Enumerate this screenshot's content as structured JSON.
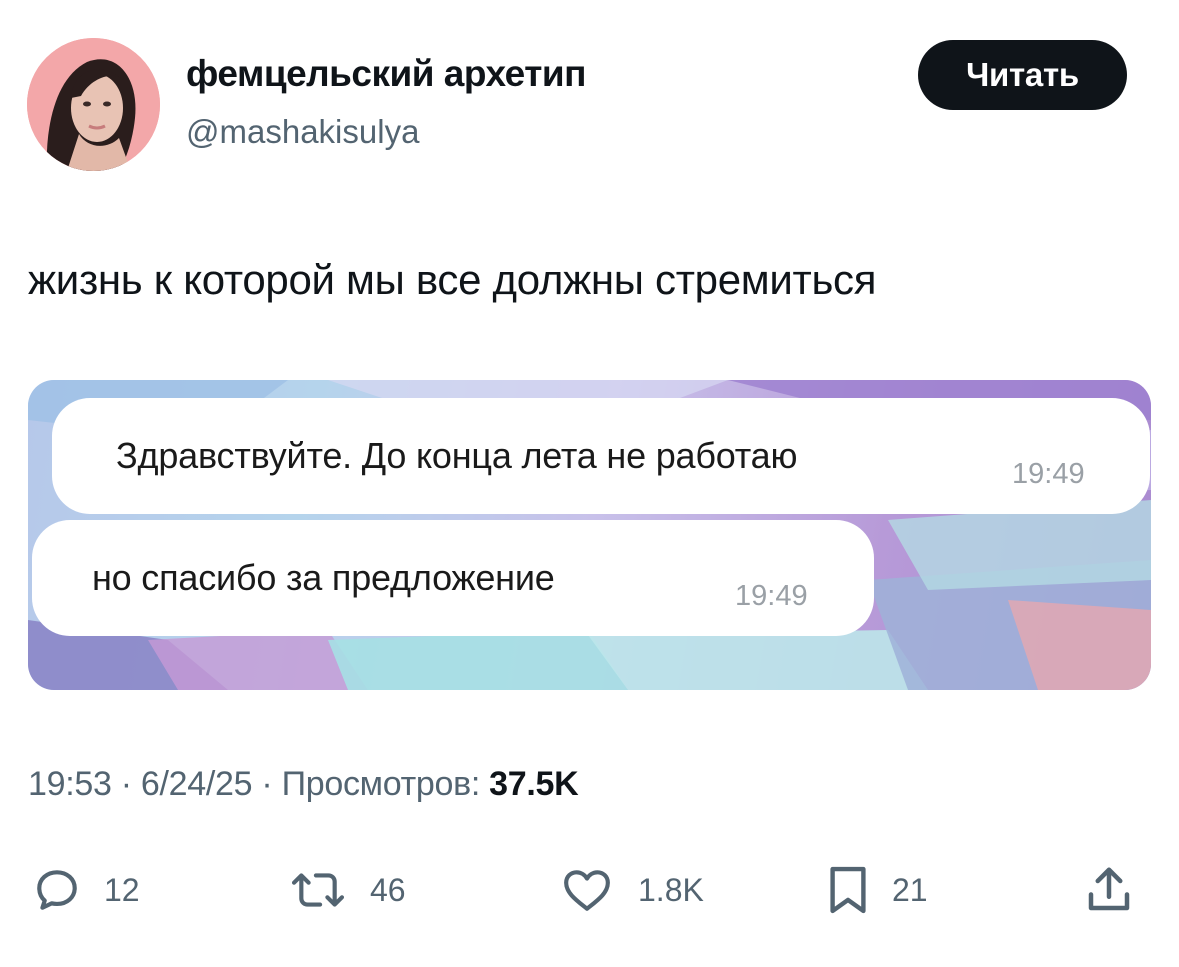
{
  "author": {
    "display_name": "фемцельский архетип",
    "handle": "@mashakisulya",
    "avatar_icon": "profile-photo"
  },
  "follow_button": {
    "label": "Читать"
  },
  "tweet": {
    "text": "жизнь к которой мы все должны стремиться"
  },
  "media": {
    "messages": [
      {
        "text": "Здравствуйте. До конца лета не работаю",
        "time": "19:49"
      },
      {
        "text": "но спасибо за предложение",
        "time": "19:49"
      }
    ]
  },
  "meta": {
    "time": "19:53",
    "separator1": " · ",
    "date": "6/24/25",
    "separator2": " · ",
    "views_label": "Просмотров: ",
    "views_count": "37.5K"
  },
  "actions": {
    "replies": {
      "icon": "reply-icon",
      "count": "12"
    },
    "retweets": {
      "icon": "retweet-icon",
      "count": "46"
    },
    "likes": {
      "icon": "heart-icon",
      "count": "1.8K"
    },
    "bookmarks": {
      "icon": "bookmark-icon",
      "count": "21"
    },
    "share": {
      "icon": "share-icon"
    }
  },
  "colors": {
    "text_primary": "#0f1419",
    "text_secondary": "#536471",
    "button_bg": "#0f1419",
    "avatar_bg": "#f3a7a9"
  }
}
